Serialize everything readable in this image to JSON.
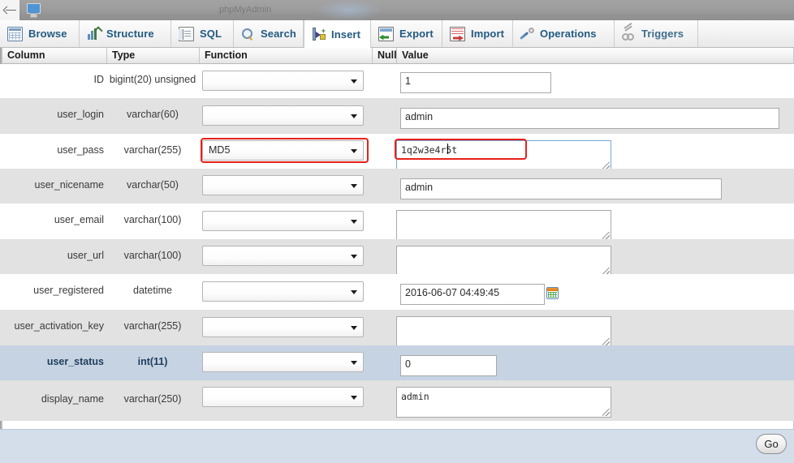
{
  "browser": {
    "back_icon": "back-arrow-icon",
    "site_icon": "monitor-icon",
    "partial_title": "phpMyAdmin"
  },
  "tabs": [
    {
      "label": "Browse",
      "icon": "browse-icon",
      "active": false,
      "disabled": false
    },
    {
      "label": "Structure",
      "icon": "structure-icon",
      "active": false,
      "disabled": false
    },
    {
      "label": "SQL",
      "icon": "sql-icon",
      "active": false,
      "disabled": false
    },
    {
      "label": "Search",
      "icon": "search-icon",
      "active": false,
      "disabled": false
    },
    {
      "label": "Insert",
      "icon": "insert-icon",
      "active": true,
      "disabled": false
    },
    {
      "label": "Export",
      "icon": "export-icon",
      "active": false,
      "disabled": false
    },
    {
      "label": "Import",
      "icon": "import-icon",
      "active": false,
      "disabled": false
    },
    {
      "label": "Operations",
      "icon": "wrench-icon",
      "active": false,
      "disabled": false
    },
    {
      "label": "Triggers",
      "icon": "triggers-icon",
      "active": false,
      "disabled": true
    }
  ],
  "table": {
    "headers": {
      "column": "Column",
      "type": "Type",
      "function": "Function",
      "null": "Null",
      "value": "Value"
    },
    "rows": [
      {
        "column": "ID",
        "type": "bigint(20) unsigned",
        "function": "",
        "value": "1",
        "field": "input",
        "highlighted": false
      },
      {
        "column": "user_login",
        "type": "varchar(60)",
        "function": "",
        "value": "admin",
        "field": "input",
        "highlighted": false
      },
      {
        "column": "user_pass",
        "type": "varchar(255)",
        "function": "MD5",
        "value": "1q2w3e4r5t",
        "field": "textarea",
        "highlighted": false,
        "focused": true,
        "annotated": true
      },
      {
        "column": "user_nicename",
        "type": "varchar(50)",
        "function": "",
        "value": "admin",
        "field": "input",
        "highlighted": false
      },
      {
        "column": "user_email",
        "type": "varchar(100)",
        "function": "",
        "value": "",
        "field": "textarea",
        "highlighted": false
      },
      {
        "column": "user_url",
        "type": "varchar(100)",
        "function": "",
        "value": "",
        "field": "textarea",
        "highlighted": false
      },
      {
        "column": "user_registered",
        "type": "datetime",
        "function": "",
        "value": "2016-06-07 04:49:45",
        "field": "input",
        "highlighted": false,
        "calendar": true
      },
      {
        "column": "user_activation_key",
        "type": "varchar(255)",
        "function": "",
        "value": "",
        "field": "textarea",
        "highlighted": false
      },
      {
        "column": "user_status",
        "type": "int(11)",
        "function": "",
        "value": "0",
        "field": "input",
        "highlighted": true
      },
      {
        "column": "display_name",
        "type": "varchar(250)",
        "function": "",
        "value": "admin",
        "field": "textarea",
        "highlighted": false
      }
    ]
  },
  "footer": {
    "go_label": "Go"
  },
  "colors": {
    "accent": "#235a81",
    "highlight_row": "#c6d3e3",
    "annotation": "#e8211a",
    "focus_border": "#7aa7d9",
    "footer_bg": "#d4ddea"
  }
}
